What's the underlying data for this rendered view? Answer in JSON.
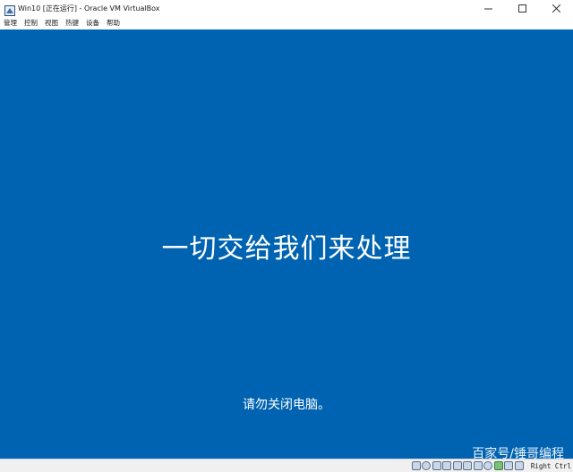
{
  "window": {
    "title": "Win10 [正在运行] - Oracle VM VirtualBox",
    "app_icon": "virtualbox-icon",
    "controls": [
      "minimize-icon",
      "maximize-icon",
      "close-icon"
    ]
  },
  "menubar": {
    "items": [
      "管理",
      "控制",
      "视图",
      "热键",
      "设备",
      "帮助"
    ]
  },
  "guest_screen": {
    "background_color": "#0063b1",
    "headline": "一切交给我们来处理",
    "subtext": "请勿关闭电脑。",
    "watermark": "百家号/锤哥编程"
  },
  "statusbar": {
    "icons": [
      "hard-disk-icon",
      "optical-drive-icon",
      "audio-icon",
      "network-icon",
      "usb-icon",
      "shared-folder-icon",
      "display-icon",
      "recording-icon",
      "cpu-icon",
      "mouse-integration-icon",
      "keyboard-icon"
    ],
    "host_key": "Right Ctrl"
  }
}
